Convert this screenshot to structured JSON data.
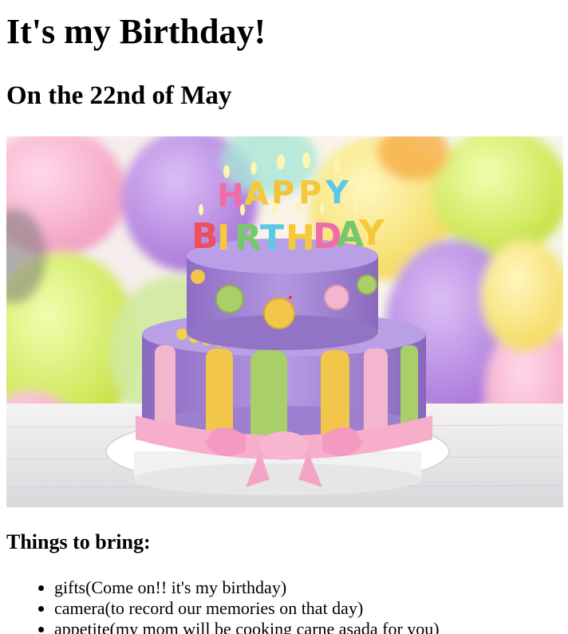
{
  "page": {
    "title": "It's my Birthday!",
    "subtitle": "On the 22nd of May",
    "section_heading": "Things to bring:",
    "cake_letters_top": [
      "H",
      "A",
      "P",
      "P",
      "Y"
    ],
    "cake_letters_bottom": [
      "B",
      "I",
      "R",
      "T",
      "H",
      "D",
      "A",
      "Y"
    ],
    "items": [
      "gifts(Come on!! it's my birthday)",
      "camera(to record our memories on that day)",
      "appetite(my mom will be cooking carne asada for you)"
    ]
  },
  "colors": {
    "cake_lavender": "#a586d6",
    "stripe_yellow": "#f2c64a",
    "stripe_green": "#a9cf6a",
    "stripe_pink": "#f4b6cf",
    "ribbon_pink": "#f7aecb",
    "balloon_green": "#cde84e",
    "balloon_purple": "#b17ee0",
    "balloon_pink": "#f6a9c8",
    "balloon_yellow": "#f5dd6a",
    "letter_pink": "#f06ca6",
    "letter_blue": "#5cc8e8",
    "letter_yellow": "#f6c93a",
    "letter_green": "#76c86a",
    "letter_red": "#ef4f5c"
  }
}
